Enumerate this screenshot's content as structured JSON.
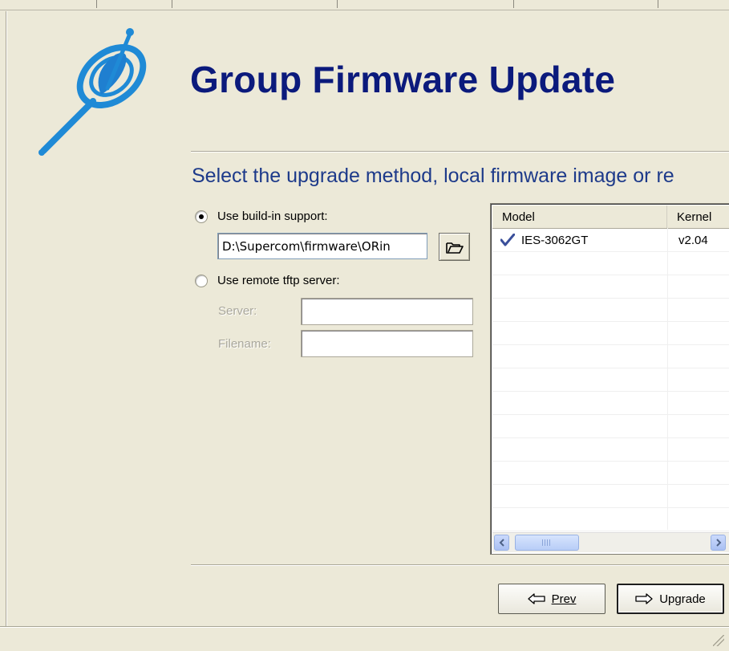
{
  "header": {
    "title": "Group Firmware Update",
    "subtitle": "Select the upgrade method, local firmware image or re"
  },
  "method": {
    "builtin_label": "Use build-in support:",
    "builtin_selected": true,
    "firmware_path": "D:\\Supercom\\firmware\\ORin",
    "browse_icon": "folder-open-icon",
    "remote_label": "Use remote tftp server:",
    "remote_selected": false,
    "server_label": "Server:",
    "server_value": "",
    "filename_label": "Filename:",
    "filename_value": ""
  },
  "device_list": {
    "columns": [
      "Model",
      "Kernel"
    ],
    "rows": [
      {
        "checked": true,
        "model": "IES-3062GT",
        "kernel": "v2.04"
      }
    ]
  },
  "buttons": {
    "prev_label": "Prev",
    "upgrade_label": "Upgrade"
  },
  "colors": {
    "title": "#0b1a7c",
    "subtitle": "#1d3a8a",
    "window_bg": "#ece9d8",
    "logo_blue": "#1f8ad6"
  }
}
